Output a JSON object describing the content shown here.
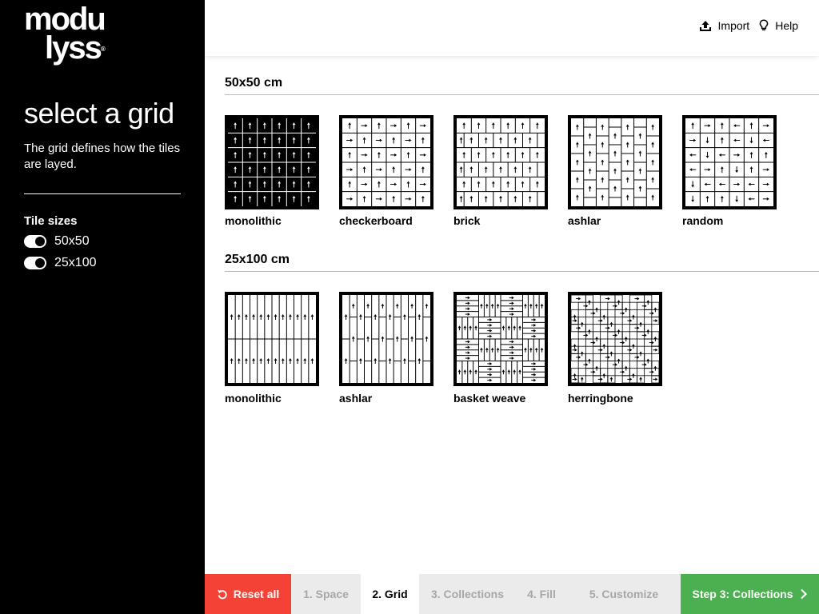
{
  "brand": {
    "line1": "modu",
    "line2": "lyss",
    "reg": "®"
  },
  "sidebar": {
    "title": "select a grid",
    "description": "The grid defines how the tiles are layed.",
    "tile_sizes_label": "Tile sizes",
    "toggles": [
      {
        "label": "50x50",
        "on": true
      },
      {
        "label": "25x100",
        "on": true
      }
    ]
  },
  "header": {
    "import_label": "Import",
    "help_label": "Help"
  },
  "sections": [
    {
      "title": "50x50 cm",
      "grids": [
        {
          "label": "monolithic",
          "icon": "grid-monolithic-50x50-icon"
        },
        {
          "label": "checkerboard",
          "icon": "grid-checkerboard-50x50-icon"
        },
        {
          "label": "brick",
          "icon": "grid-brick-50x50-icon"
        },
        {
          "label": "ashlar",
          "icon": "grid-ashlar-50x50-icon"
        },
        {
          "label": "random",
          "icon": "grid-random-50x50-icon"
        }
      ]
    },
    {
      "title": "25x100 cm",
      "grids": [
        {
          "label": "monolithic",
          "icon": "grid-monolithic-25x100-icon"
        },
        {
          "label": "ashlar",
          "icon": "grid-ashlar-25x100-icon"
        },
        {
          "label": "basket weave",
          "icon": "grid-basket-weave-25x100-icon"
        },
        {
          "label": "herringbone",
          "icon": "grid-herringbone-25x100-icon"
        }
      ]
    }
  ],
  "footer": {
    "reset_label": "Reset all",
    "steps": [
      "1. Space",
      "2. Grid",
      "3. Collections",
      "4. Fill",
      "5. Customize"
    ],
    "active_step": "2. Grid",
    "next_label": "Step 3: Collections"
  },
  "colors": {
    "sidebar_bg": "#000000",
    "reset": "#f44336",
    "next": "#4caf50",
    "step_inactive_bg": "#ebebeb",
    "step_inactive_text": "#a7a7a7"
  }
}
